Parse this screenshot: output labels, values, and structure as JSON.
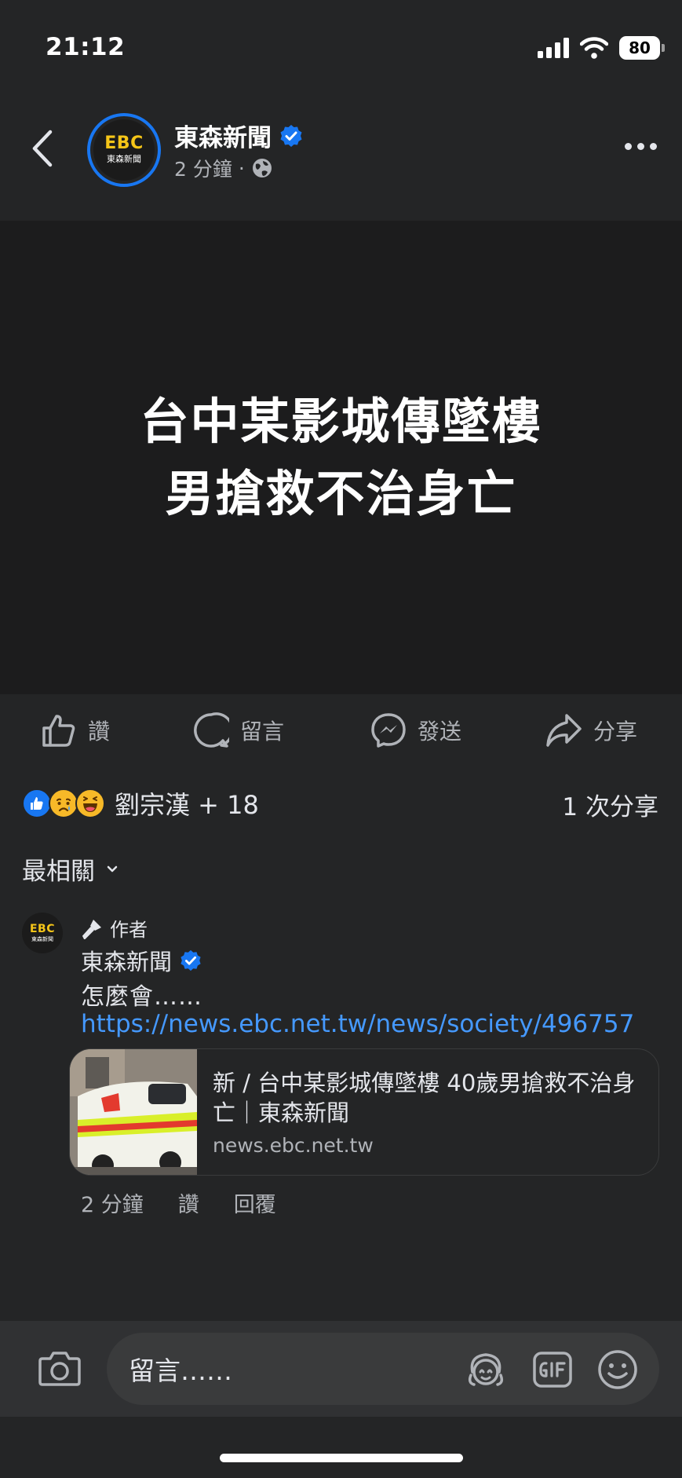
{
  "status_bar": {
    "time": "21:12",
    "battery": "80"
  },
  "header": {
    "page_name": "東森新聞",
    "time_ago": "2 分鐘",
    "dot": "·",
    "avatar_logo": "EBC",
    "avatar_sub": "東森新聞"
  },
  "media": {
    "line1": "台中某影城傳墜樓",
    "line2": "男搶救不治身亡"
  },
  "actions": {
    "like": "讚",
    "comment": "留言",
    "send": "發送",
    "share": "分享"
  },
  "reactions": {
    "names": "劉宗漢 + 18",
    "shares": "1 次分享"
  },
  "sort": {
    "label": "最相關"
  },
  "comment": {
    "author_badge": "作者",
    "name": "東森新聞",
    "text": "怎麼會……",
    "link": "https://news.ebc.net.tw/news/society/496757",
    "card_title": "新 / 台中某影城傳墜樓 40歲男搶救不治身亡｜東森新聞",
    "card_domain": "news.ebc.net.tw",
    "time_ago": "2 分鐘",
    "like": "讚",
    "reply": "回覆"
  },
  "composer": {
    "placeholder": "留言……"
  },
  "colors": {
    "background": "#242526",
    "accent": "#1877f2",
    "link": "#4599ff",
    "muted": "#b0b3b8"
  }
}
